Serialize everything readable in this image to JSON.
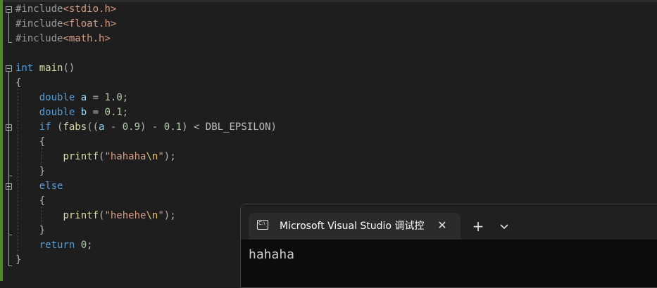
{
  "editor": {
    "lines": [
      {
        "parts": [
          {
            "t": "#include",
            "c": "pp"
          },
          {
            "t": "<stdio.h>",
            "c": "inc"
          }
        ]
      },
      {
        "parts": [
          {
            "t": "#include",
            "c": "pp"
          },
          {
            "t": "<float.h>",
            "c": "inc"
          }
        ]
      },
      {
        "parts": [
          {
            "t": "#include",
            "c": "pp"
          },
          {
            "t": "<math.h>",
            "c": "inc"
          }
        ]
      },
      {
        "parts": []
      },
      {
        "parts": [
          {
            "t": "int",
            "c": "kw"
          },
          {
            "t": " ",
            "c": "punc"
          },
          {
            "t": "main",
            "c": "fn"
          },
          {
            "t": "()",
            "c": "punc"
          }
        ]
      },
      {
        "parts": [
          {
            "t": "{",
            "c": "punc"
          }
        ]
      },
      {
        "parts": [
          {
            "t": "    ",
            "c": "punc"
          },
          {
            "t": "double",
            "c": "kw"
          },
          {
            "t": " ",
            "c": "punc"
          },
          {
            "t": "a",
            "c": "var"
          },
          {
            "t": " = ",
            "c": "punc"
          },
          {
            "t": "1.0",
            "c": "num"
          },
          {
            "t": ";",
            "c": "punc"
          }
        ]
      },
      {
        "parts": [
          {
            "t": "    ",
            "c": "punc"
          },
          {
            "t": "double",
            "c": "kw"
          },
          {
            "t": " ",
            "c": "punc"
          },
          {
            "t": "b",
            "c": "var"
          },
          {
            "t": " = ",
            "c": "punc"
          },
          {
            "t": "0.1",
            "c": "num"
          },
          {
            "t": ";",
            "c": "punc"
          }
        ]
      },
      {
        "parts": [
          {
            "t": "    ",
            "c": "punc"
          },
          {
            "t": "if",
            "c": "kw"
          },
          {
            "t": " (",
            "c": "punc"
          },
          {
            "t": "fabs",
            "c": "fn"
          },
          {
            "t": "((",
            "c": "punc"
          },
          {
            "t": "a",
            "c": "var"
          },
          {
            "t": " - ",
            "c": "punc"
          },
          {
            "t": "0.9",
            "c": "num"
          },
          {
            "t": ") - ",
            "c": "punc"
          },
          {
            "t": "0.1",
            "c": "num"
          },
          {
            "t": ") < ",
            "c": "punc"
          },
          {
            "t": "DBL_EPSILON",
            "c": "mac"
          },
          {
            "t": ")",
            "c": "punc"
          }
        ]
      },
      {
        "parts": [
          {
            "t": "    {",
            "c": "punc"
          }
        ]
      },
      {
        "parts": [
          {
            "t": "        ",
            "c": "punc"
          },
          {
            "t": "printf",
            "c": "fn"
          },
          {
            "t": "(",
            "c": "punc"
          },
          {
            "t": "\"hahaha",
            "c": "str"
          },
          {
            "t": "\\n",
            "c": "esc"
          },
          {
            "t": "\"",
            "c": "str"
          },
          {
            "t": ");",
            "c": "punc"
          }
        ]
      },
      {
        "parts": [
          {
            "t": "    }",
            "c": "punc"
          }
        ]
      },
      {
        "parts": [
          {
            "t": "    ",
            "c": "punc"
          },
          {
            "t": "else",
            "c": "kw"
          }
        ]
      },
      {
        "parts": [
          {
            "t": "    {",
            "c": "punc"
          }
        ]
      },
      {
        "parts": [
          {
            "t": "        ",
            "c": "punc"
          },
          {
            "t": "printf",
            "c": "fn"
          },
          {
            "t": "(",
            "c": "punc"
          },
          {
            "t": "\"hehehe",
            "c": "str"
          },
          {
            "t": "\\n",
            "c": "esc"
          },
          {
            "t": "\"",
            "c": "str"
          },
          {
            "t": ");",
            "c": "punc"
          }
        ]
      },
      {
        "parts": [
          {
            "t": "    }",
            "c": "punc"
          }
        ]
      },
      {
        "parts": [
          {
            "t": "    ",
            "c": "punc"
          },
          {
            "t": "return",
            "c": "kw"
          },
          {
            "t": " ",
            "c": "punc"
          },
          {
            "t": "0",
            "c": "num"
          },
          {
            "t": ";",
            "c": "punc"
          }
        ]
      },
      {
        "parts": [
          {
            "t": "}",
            "c": "punc"
          }
        ]
      }
    ]
  },
  "terminal": {
    "tab_title": "Microsoft Visual Studio 调试控制台",
    "tab_icon": "console-icon",
    "icon_glyph": "C:\\",
    "close_glyph": "✕",
    "new_tab_glyph": "+",
    "output": "hahaha"
  },
  "colors": {
    "editor_bg": "#1e1e1e",
    "keyword": "#569cd6",
    "function": "#dcdcaa",
    "variable": "#9cdcfe",
    "number": "#b5cea8",
    "string": "#d69d85",
    "change_margin": "#4e8a2c"
  }
}
